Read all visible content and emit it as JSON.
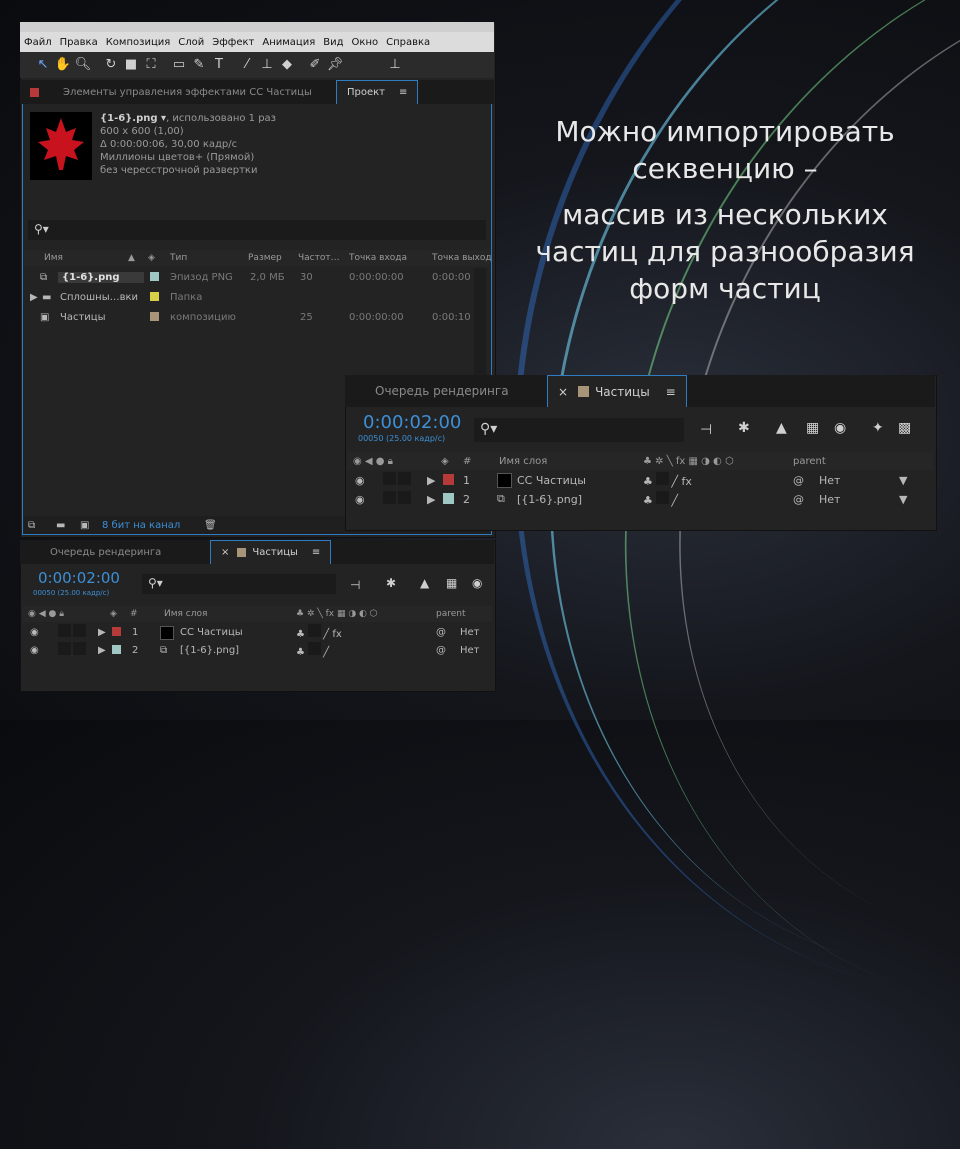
{
  "menu": [
    "Файл",
    "Правка",
    "Композиция",
    "Слой",
    "Эффект",
    "Анимация",
    "Вид",
    "Окно",
    "Справка"
  ],
  "tools": [
    "cursor-icon",
    "hand-icon",
    "zoom-icon",
    "rotate-icon",
    "camera-icon",
    "pan-behind-icon",
    "rectangle-icon",
    "pen-icon",
    "text-icon",
    "brush-icon",
    "clone-stamp-icon",
    "eraser-icon",
    "roto-brush-icon",
    "puppet-pin-icon",
    "axis-icon"
  ],
  "project_tabs": {
    "effects": "Элементы управления эффектами CC Частицы",
    "project": "Проект"
  },
  "preview": {
    "name": "{1-6}.png",
    "used": ", использовано 1 раз",
    "size": "600 x 600 (1,00)",
    "duration": "Δ 0:00:00:06, 30,00 кадр/с",
    "colors": "Миллионы цветов+ (Прямой)",
    "interlace": "без чересстрочной развертки"
  },
  "search_icon": "search-icon",
  "columns": [
    "Имя",
    "Тип",
    "Размер",
    "Частот…",
    "Точка входа",
    "Точка выход"
  ],
  "items": [
    {
      "name": "{1-6}.png",
      "label_color": "#9fc7c4",
      "type": "Эпизод PNG",
      "size": "2,0 МБ",
      "fps": "30",
      "in": "0:00:00:00",
      "out": "0:00:00"
    },
    {
      "name": "Сплошны…вки",
      "label_color": "#d8cf49",
      "type": "Папка",
      "size": "",
      "fps": "",
      "in": "",
      "out": ""
    },
    {
      "name": "Частицы",
      "label_color": "#a89478",
      "type": "композицию",
      "size": "",
      "fps": "25",
      "in": "0:00:00:00",
      "out": "0:00:10"
    }
  ],
  "footer_bits": "8 бит на канал",
  "comp_large": {
    "tab_render": "Очередь рендеринга",
    "tab_comp": "Частицы",
    "timecode": "0:00:02:00",
    "frames": "00050 (25.00 кадр/с)",
    "col_name": "Имя слоя",
    "col_parent": "parent",
    "col_hash": "#",
    "layers": [
      {
        "num": "1",
        "name": "CC Частицы",
        "color": "#b73a3a",
        "parent": "Нет"
      },
      {
        "num": "2",
        "name": "[{1-6}.png]",
        "color": "#9fc7c4",
        "parent": "Нет"
      }
    ]
  },
  "comp_small": {
    "tab_render": "Очередь рендеринга",
    "tab_comp": "Частицы",
    "timecode": "0:00:02:00",
    "frames": "00050 (25.00 кадр/с)",
    "col_name": "Имя слоя",
    "col_parent": "parent",
    "col_hash": "#",
    "layers": [
      {
        "num": "1",
        "name": "CC Частицы",
        "color": "#b73a3a",
        "parent": "Нет"
      },
      {
        "num": "2",
        "name": "[{1-6}.png]",
        "color": "#9fc7c4",
        "parent": "Нет"
      }
    ]
  },
  "slide_text": {
    "line1": "Можно импортировать",
    "line2": "секвенцию –",
    "line3": "массив из нескольких",
    "line4": "частиц для разнообразия",
    "line5": "форм частиц"
  }
}
